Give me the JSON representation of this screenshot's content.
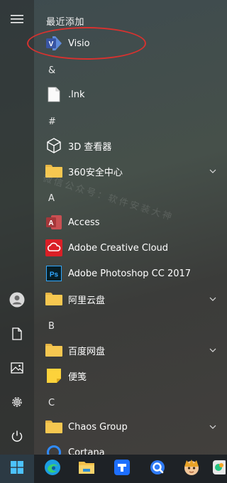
{
  "start_menu": {
    "recent_section_title": "最近添加",
    "recent_items": [
      {
        "label": "Visio",
        "icon": "visio-icon"
      }
    ],
    "groups": [
      {
        "letter": "&",
        "items": [
          {
            "label": ".lnk",
            "icon": "document-icon"
          }
        ]
      },
      {
        "letter": "#",
        "items": [
          {
            "label": "3D 查看器",
            "icon": "3d-viewer-icon"
          },
          {
            "label": "360安全中心",
            "icon": "folder-icon",
            "expandable": true
          }
        ]
      },
      {
        "letter": "A",
        "items": [
          {
            "label": "Access",
            "icon": "access-icon"
          },
          {
            "label": "Adobe Creative Cloud",
            "icon": "creative-cloud-icon"
          },
          {
            "label": "Adobe Photoshop CC 2017",
            "icon": "photoshop-icon"
          },
          {
            "label": "阿里云盘",
            "icon": "folder-icon",
            "expandable": true
          }
        ]
      },
      {
        "letter": "B",
        "items": [
          {
            "label": "百度网盘",
            "icon": "folder-icon",
            "expandable": true
          },
          {
            "label": "便笺",
            "icon": "sticky-notes-icon"
          }
        ]
      },
      {
        "letter": "C",
        "items": [
          {
            "label": "Chaos Group",
            "icon": "folder-icon",
            "expandable": true
          },
          {
            "label": "Cortana",
            "icon": "cortana-icon"
          }
        ]
      }
    ],
    "watermark": "微信公众号：软件安装大神"
  },
  "left_rail": [
    "hamburger-menu-icon",
    "user-icon",
    "documents-icon",
    "pictures-icon",
    "settings-icon",
    "power-icon"
  ],
  "taskbar": [
    "windows-start-icon",
    "edge-icon",
    "file-explorer-icon",
    "tencent-docs-icon",
    "quark-icon",
    "anime-avatar-icon",
    "app-icon"
  ],
  "colors": {
    "accent_red_ring": "#d8322f",
    "folder": "#f6c750",
    "access": "#a4373a",
    "photoshop": "#31a8ff",
    "visio": "#3955a3",
    "taskbar_bg": "#1e2226"
  }
}
